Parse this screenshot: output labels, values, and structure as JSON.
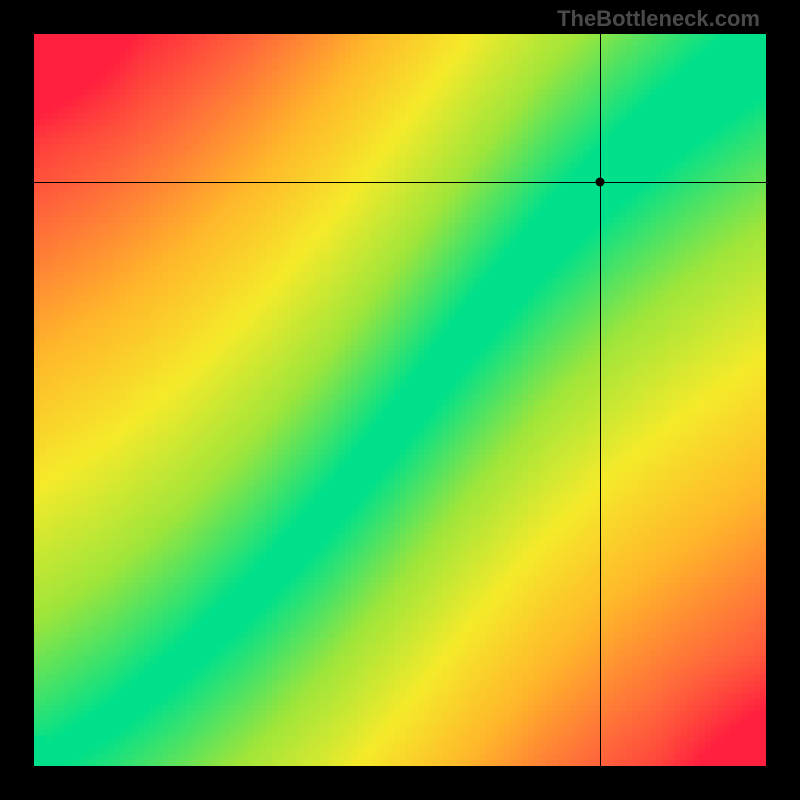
{
  "watermark": "TheBottleneck.com",
  "chart_data": {
    "type": "heatmap",
    "title": "",
    "xlabel": "",
    "ylabel": "",
    "grid_resolution": 120,
    "x_range": [
      0,
      1
    ],
    "y_range": [
      0,
      1
    ],
    "marker": {
      "x": 0.773,
      "y": 0.798
    },
    "crosshair": {
      "x": 0.773,
      "y": 0.798
    },
    "optimal_curve_samples": [
      {
        "x": 0.0,
        "y": 0.0
      },
      {
        "x": 0.1,
        "y": 0.06
      },
      {
        "x": 0.2,
        "y": 0.14
      },
      {
        "x": 0.3,
        "y": 0.235
      },
      {
        "x": 0.4,
        "y": 0.345
      },
      {
        "x": 0.5,
        "y": 0.47
      },
      {
        "x": 0.6,
        "y": 0.6
      },
      {
        "x": 0.7,
        "y": 0.72
      },
      {
        "x": 0.8,
        "y": 0.82
      },
      {
        "x": 0.9,
        "y": 0.905
      },
      {
        "x": 1.0,
        "y": 0.98
      }
    ],
    "band_half_width": 0.05,
    "color_stops": [
      {
        "t": 0.0,
        "color": "#00e08a"
      },
      {
        "t": 0.2,
        "color": "#9fe53a"
      },
      {
        "t": 0.4,
        "color": "#f5ea2a"
      },
      {
        "t": 0.6,
        "color": "#ffb62a"
      },
      {
        "t": 0.8,
        "color": "#ff6a3a"
      },
      {
        "t": 1.0,
        "color": "#ff1f3e"
      }
    ],
    "legend": []
  }
}
